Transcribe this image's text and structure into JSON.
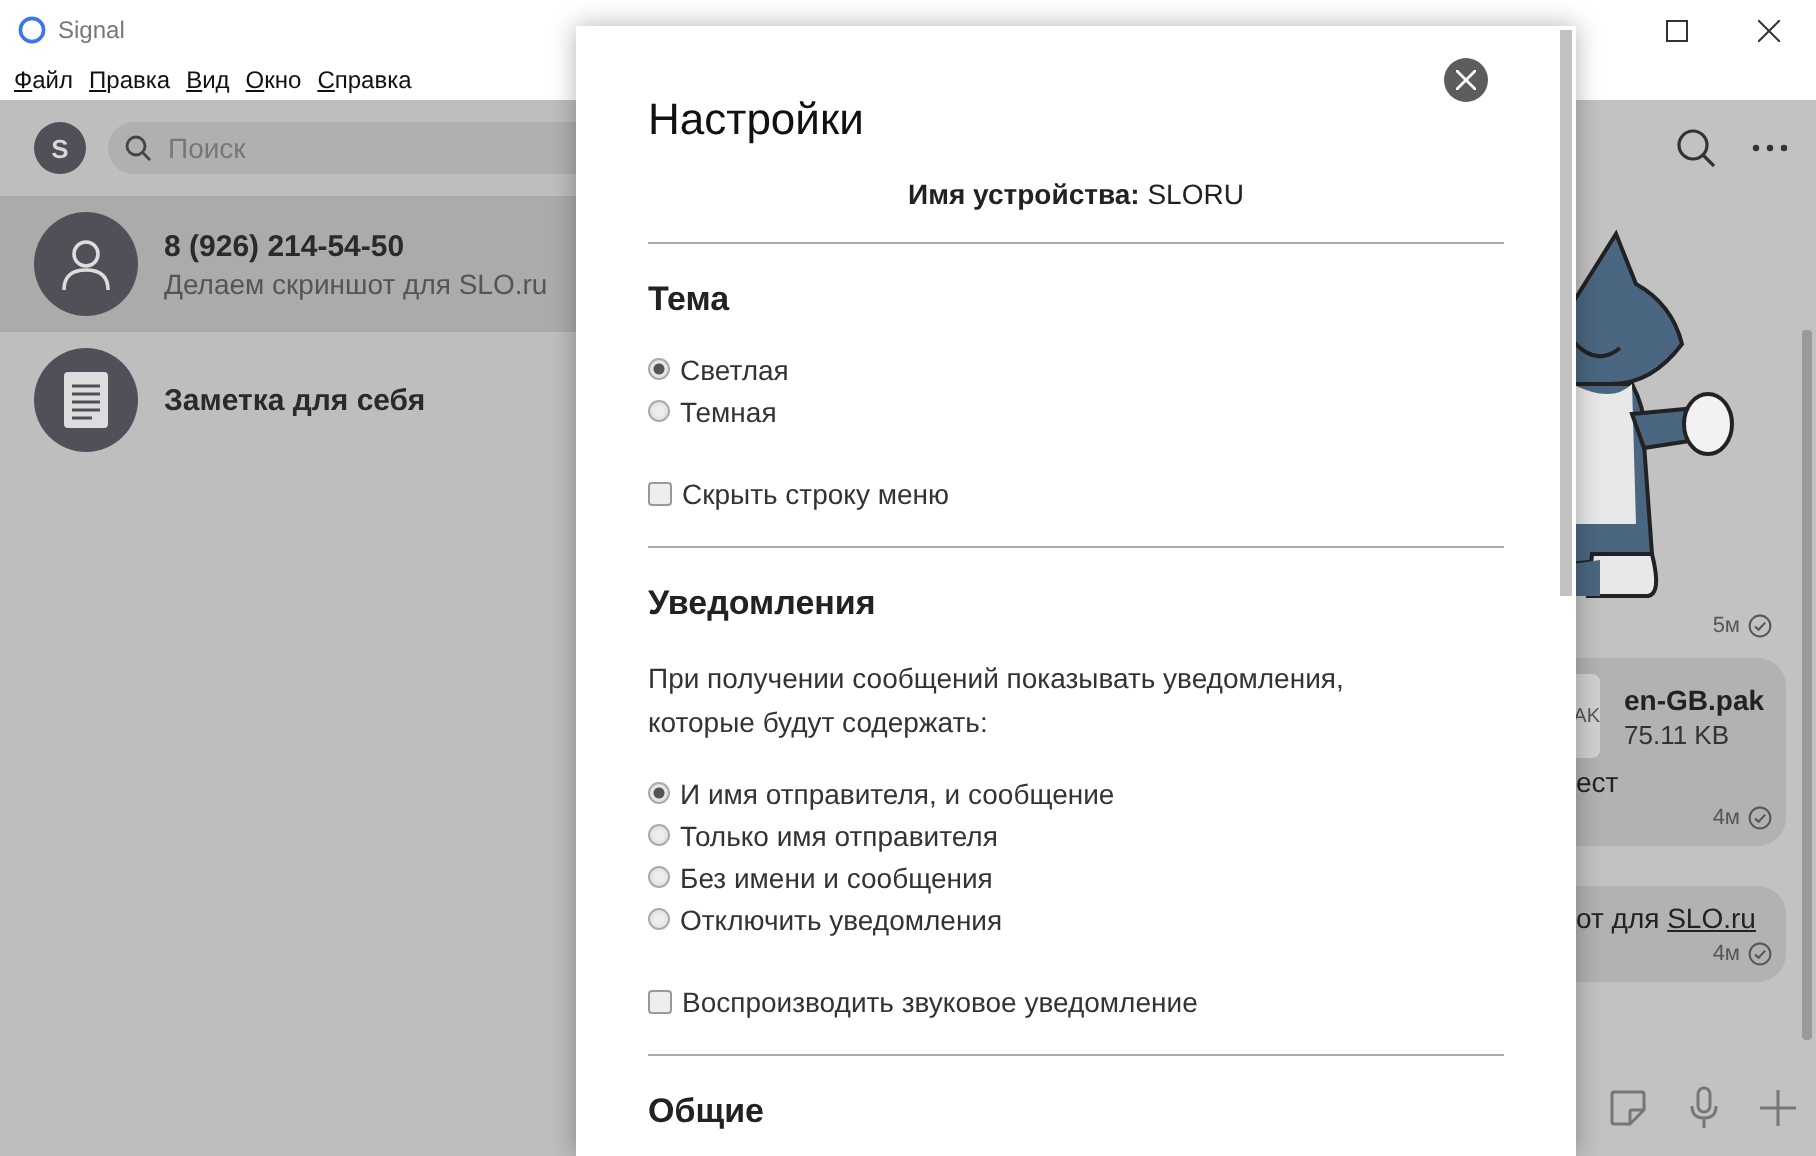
{
  "window": {
    "title": "Signal",
    "menu": [
      "Файл",
      "Правка",
      "Вид",
      "Окно",
      "Справка"
    ]
  },
  "sidebar": {
    "profile_initial": "S",
    "search": {
      "placeholder": "Поиск"
    },
    "conversations": [
      {
        "kind": "person",
        "title": "8 (926) 214-54-50",
        "preview": "Делаем скриншот для SLO.ru",
        "selected": true
      },
      {
        "kind": "note",
        "title": "Заметка для себя",
        "selected": false
      }
    ]
  },
  "chat": {
    "messages": [
      {
        "kind": "sticker",
        "time": "5м"
      },
      {
        "kind": "file",
        "file_type": "AK",
        "file_name": "en-GB.pak",
        "file_size": "75.11 KB",
        "text": "ест",
        "time": "4м"
      },
      {
        "kind": "text",
        "text": "от для ",
        "link": "SLO.ru",
        "time": "4м"
      }
    ]
  },
  "settings": {
    "title": "Настройки",
    "device_label": "Имя устройства:",
    "device_name": "SLORU",
    "sections": [
      {
        "heading": "Тема",
        "options": [
          {
            "label": "Светлая",
            "selected": true
          },
          {
            "label": "Темная",
            "selected": false
          }
        ],
        "checkbox": {
          "label": "Скрыть строку меню",
          "checked": false
        }
      },
      {
        "heading": "Уведомления",
        "description": "При получении сообщений показывать уведомления, которые будут содержать:",
        "options": [
          {
            "label": "И имя отправителя, и сообщение",
            "selected": true
          },
          {
            "label": "Только имя отправителя",
            "selected": false
          },
          {
            "label": "Без имени и сообщения",
            "selected": false
          },
          {
            "label": "Отключить уведомления",
            "selected": false
          }
        ],
        "checkbox": {
          "label": "Воспроизводить звуковое уведомление",
          "checked": false
        }
      },
      {
        "heading": "Общие"
      }
    ]
  }
}
